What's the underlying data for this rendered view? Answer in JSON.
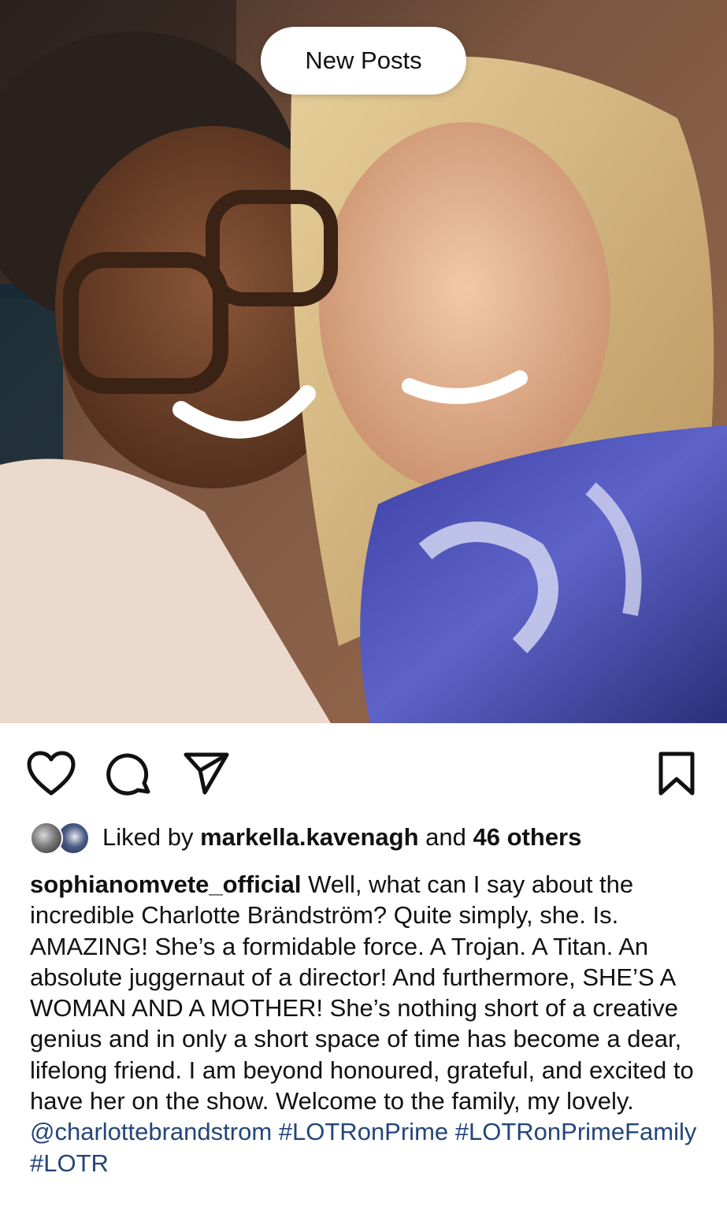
{
  "banner": {
    "new_posts_label": "New Posts"
  },
  "post": {
    "photo": {
      "icon": "selfie-photo"
    },
    "actions": {
      "like_icon": "heart-icon",
      "comment_icon": "comment-icon",
      "share_icon": "paper-plane-icon",
      "save_icon": "bookmark-icon"
    },
    "likes": {
      "prefix": "Liked by",
      "user": "markella.kavenagh",
      "middle": "and",
      "others": "46 others"
    },
    "caption": {
      "username": "sophianomvete_official",
      "text": "Well, what can I say about the incredible Charlotte Brändström? Quite simply, she. Is. AMAZING! She’s a formidable force. A Trojan. A Titan. An absolute juggernaut of a director! And furthermore, SHE’S A WOMAN AND A MOTHER! She’s nothing short of a creative genius and in only a short space of time has become a dear, lifelong friend. I am beyond honoured, grateful, and excited to have her on the show. Welcome to the family, my lovely.",
      "mention": "@charlottebrandstrom",
      "hashtags": [
        "#LOTRonPrime",
        "#LOTRonPrimeFamily",
        "#LOTR"
      ]
    }
  },
  "colors": {
    "link": "#24457a",
    "text": "#111111",
    "background": "#ffffff"
  }
}
